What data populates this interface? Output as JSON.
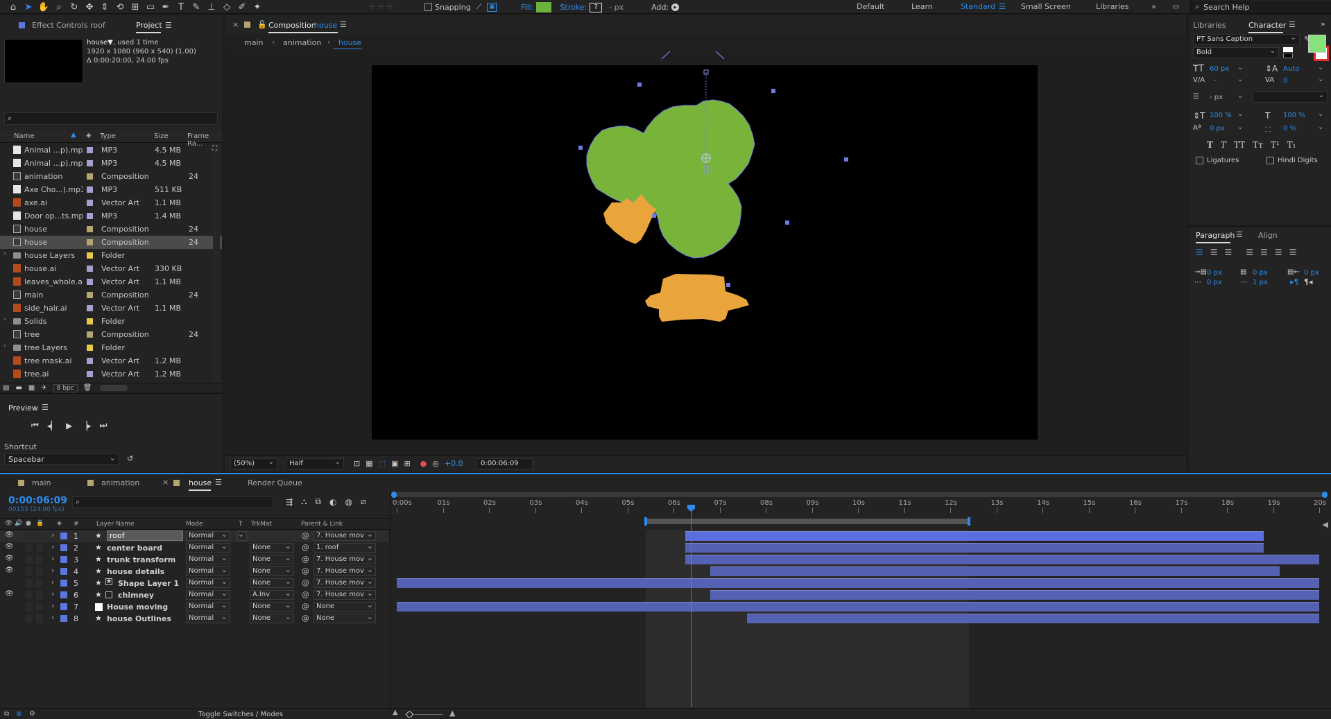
{
  "toolbar": {
    "snapping_label": "Snapping",
    "fill_label": "Fill:",
    "stroke_label": "Stroke:",
    "stroke_width": "- px",
    "add_label": "Add:",
    "fill_color": "#6bb33a",
    "workspaces": [
      "Default",
      "Learn",
      "Standard",
      "Small Screen",
      "Libraries"
    ],
    "active_workspace": "Standard",
    "search_placeholder": "Search Help"
  },
  "left_panel": {
    "tabs": [
      "Effect Controls roof",
      "Project"
    ],
    "active_tab": "Project",
    "item_name": "house▼",
    "item_used": ", used 1 time",
    "item_dims": "1920 x 1080  (960 x 540) (1.00)",
    "item_duration": "Δ 0:00:20:00, 24.00 fps",
    "columns": [
      "Name",
      "Type",
      "Size",
      "Frame Ra..."
    ],
    "items": [
      {
        "name": "Animal ...p).mp3",
        "type": "MP3",
        "size": "4.5 MB",
        "fr": "",
        "kind": "audio",
        "label": "#a99ed0"
      },
      {
        "name": "Animal ...p).mp3",
        "type": "MP3",
        "size": "4.5 MB",
        "fr": "",
        "kind": "audio",
        "label": "#a99ed0"
      },
      {
        "name": "animation",
        "type": "Composition",
        "size": "",
        "fr": "24",
        "kind": "comp",
        "label": "#b5a56f"
      },
      {
        "name": "Axe Cho...).mp3",
        "type": "MP3",
        "size": "511 KB",
        "fr": "",
        "kind": "audio",
        "label": "#a99ed0"
      },
      {
        "name": "axe.ai",
        "type": "Vector Art",
        "size": "1.1 MB",
        "fr": "",
        "kind": "ai",
        "label": "#a99ed0"
      },
      {
        "name": "Door op...ts.mp3",
        "type": "MP3",
        "size": "1.4 MB",
        "fr": "",
        "kind": "audio",
        "label": "#a99ed0"
      },
      {
        "name": "house",
        "type": "Composition",
        "size": "",
        "fr": "24",
        "kind": "comp",
        "label": "#b5a56f"
      },
      {
        "name": "house",
        "type": "Composition",
        "size": "",
        "fr": "24",
        "kind": "comp",
        "label": "#b5a56f"
      },
      {
        "name": "house Layers",
        "type": "Folder",
        "size": "",
        "fr": "",
        "kind": "folder",
        "label": "#e6c84b"
      },
      {
        "name": "house.ai",
        "type": "Vector Art",
        "size": "330 KB",
        "fr": "",
        "kind": "ai",
        "label": "#a99ed0"
      },
      {
        "name": "leaves_whole.ai",
        "type": "Vector Art",
        "size": "1.1 MB",
        "fr": "",
        "kind": "ai",
        "label": "#a99ed0"
      },
      {
        "name": "main",
        "type": "Composition",
        "size": "",
        "fr": "24",
        "kind": "comp",
        "label": "#b5a56f"
      },
      {
        "name": "side_hair.ai",
        "type": "Vector Art",
        "size": "1.1 MB",
        "fr": "",
        "kind": "ai",
        "label": "#a99ed0"
      },
      {
        "name": "Solids",
        "type": "Folder",
        "size": "",
        "fr": "",
        "kind": "folder",
        "label": "#e6c84b"
      },
      {
        "name": "tree",
        "type": "Composition",
        "size": "",
        "fr": "24",
        "kind": "comp",
        "label": "#b5a56f"
      },
      {
        "name": "tree Layers",
        "type": "Folder",
        "size": "",
        "fr": "",
        "kind": "folder",
        "label": "#e6c84b"
      },
      {
        "name": "tree mask.ai",
        "type": "Vector Art",
        "size": "1.2 MB",
        "fr": "",
        "kind": "ai",
        "label": "#a99ed0"
      },
      {
        "name": "tree.ai",
        "type": "Vector Art",
        "size": "1.2 MB",
        "fr": "",
        "kind": "ai",
        "label": "#a99ed0"
      }
    ],
    "selected_index": 7,
    "bpc_label": "8 bpc"
  },
  "preview": {
    "title": "Preview",
    "shortcut_label": "Shortcut",
    "shortcut_value": "Spacebar"
  },
  "composition": {
    "tab_prefix": "Composition",
    "tab_name": "house",
    "breadcrumbs": [
      "main",
      "animation",
      "house"
    ],
    "zoom": "(50%)",
    "resolution": "Half",
    "exposure": "+0.0",
    "timecode": "0:00:06:09"
  },
  "character": {
    "tabs": [
      "Libraries",
      "Character"
    ],
    "font": "PT Sans Caption",
    "style": "Bold",
    "font_size": "60 px",
    "leading": "Auto",
    "kerning": "-",
    "tracking": "0",
    "stroke_width": "- px",
    "vert_scale": "100 %",
    "horiz_scale": "100 %",
    "baseline": "0 px",
    "tsume": "0 %",
    "ligatures": "Ligatures",
    "hindi_digits": "Hindi Digits",
    "fill_color": "#86e27a"
  },
  "paragraph": {
    "tabs": [
      "Paragraph",
      "Align"
    ],
    "indent_left": "0 px",
    "indent_first": "0 px",
    "indent_right": "0 px",
    "space_before": "0 px",
    "space_after": "1 px"
  },
  "timeline": {
    "tabs": [
      "main",
      "animation",
      "house",
      "Render Queue"
    ],
    "active_tab": "house",
    "timecode": "0:00:06:09",
    "frame_info": "00153 (24.00 fps)",
    "columns": [
      "#",
      "Layer Name",
      "Mode",
      "T",
      "TrkMat",
      "Parent & Link"
    ],
    "ruler": [
      "0:00s",
      "01s",
      "02s",
      "03s",
      "04s",
      "05s",
      "06s",
      "07s",
      "08s",
      "09s",
      "10s",
      "11s",
      "12s",
      "13s",
      "14s",
      "15s",
      "16s",
      "17s",
      "18s",
      "19s",
      "20s"
    ],
    "duration_seconds": 20,
    "playhead_seconds": 6.375,
    "work_area": [
      5.4,
      12.4
    ],
    "layers": [
      {
        "num": "1",
        "name": "roof",
        "mode": "Normal",
        "trkmat": "",
        "parent": "7. House mov",
        "start": 6.25,
        "end": 18.8,
        "icon": "star",
        "eye": true,
        "selected": true
      },
      {
        "num": "2",
        "name": "center board",
        "mode": "Normal",
        "trkmat": "None",
        "parent": "1. roof",
        "start": 6.25,
        "end": 18.8,
        "icon": "star",
        "eye": true,
        "selected": false
      },
      {
        "num": "3",
        "name": "trunk transform",
        "mode": "Normal",
        "trkmat": "None",
        "parent": "7. House mov",
        "start": 6.25,
        "end": 20,
        "icon": "star",
        "eye": true,
        "selected": false
      },
      {
        "num": "4",
        "name": "house details",
        "mode": "Normal",
        "trkmat": "None",
        "parent": "7. House mov",
        "start": 6.8,
        "end": 19.15,
        "icon": "star",
        "eye": true,
        "selected": false
      },
      {
        "num": "5",
        "name": "Shape Layer 1",
        "mode": "Normal",
        "trkmat": "None",
        "parent": "7. House mov",
        "start": 0,
        "end": 20,
        "icon": "star-shape",
        "eye": false,
        "selected": false
      },
      {
        "num": "6",
        "name": "chimney",
        "mode": "Normal",
        "trkmat": "A.Inv",
        "parent": "7. House mov",
        "start": 6.8,
        "end": 20,
        "icon": "star-box",
        "eye": true,
        "selected": false
      },
      {
        "num": "7",
        "name": "House moving",
        "mode": "Normal",
        "trkmat": "None",
        "parent": "None",
        "start": 0,
        "end": 20,
        "icon": "null",
        "eye": false,
        "selected": false
      },
      {
        "num": "8",
        "name": "house Outlines",
        "mode": "Normal",
        "trkmat": "None",
        "parent": "None",
        "start": 7.6,
        "end": 20,
        "icon": "star",
        "eye": false,
        "selected": false
      }
    ],
    "toggle_label": "Toggle Switches / Modes"
  },
  "colors": {
    "accent": "#2d8ceb",
    "layer_label": "#5a78e0",
    "bar": "#5562b3",
    "tree_green": "#79b43a",
    "house_orange": "#e9a53b"
  }
}
